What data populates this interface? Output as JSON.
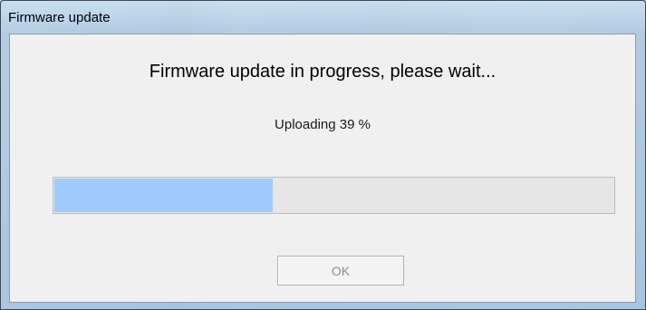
{
  "window": {
    "title": "Firmware update"
  },
  "dialog": {
    "heading": "Firmware update in progress, please wait...",
    "status_text": "Uploading 39 %",
    "progress_value": 0.39,
    "ok_label": "OK",
    "ok_enabled": false
  },
  "colors": {
    "progress_fill": "#9fcafa",
    "progress_track": "#e6e6e6",
    "client_background": "#f0f0f0"
  }
}
